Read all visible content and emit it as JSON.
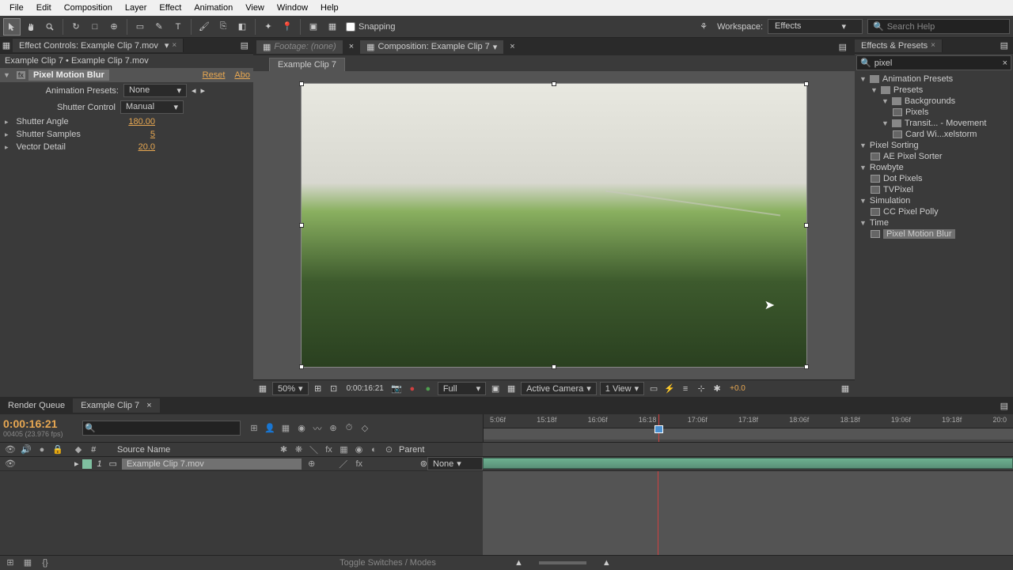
{
  "menubar": [
    "File",
    "Edit",
    "Composition",
    "Layer",
    "Effect",
    "Animation",
    "View",
    "Window",
    "Help"
  ],
  "toolbar": {
    "snapping_label": "Snapping",
    "workspace_label": "Workspace:",
    "workspace_value": "Effects",
    "search_placeholder": "Search Help"
  },
  "effect_controls": {
    "tab_title": "Effect Controls: Example Clip 7.mov",
    "breadcrumb": "Example Clip 7 • Example Clip 7.mov",
    "effect_name": "Pixel Motion Blur",
    "reset_label": "Reset",
    "about_label": "Abo",
    "preset_label": "Animation Presets:",
    "preset_value": "None",
    "props": [
      {
        "label": "Shutter Control",
        "value": "Manual",
        "type": "dropdown"
      },
      {
        "label": "Shutter Angle",
        "value": "180.00",
        "type": "value"
      },
      {
        "label": "Shutter Samples",
        "value": "5",
        "type": "value"
      },
      {
        "label": "Vector Detail",
        "value": "20.0",
        "type": "value"
      }
    ]
  },
  "composition": {
    "footage_tab": "Footage: (none)",
    "comp_tab": "Composition: Example Clip 7",
    "viewer_tab": "Example Clip 7",
    "footer": {
      "zoom": "50%",
      "timecode": "0:00:16:21",
      "resolution": "Full",
      "camera": "Active Camera",
      "view": "1 View",
      "exposure": "+0.0"
    }
  },
  "effects_presets": {
    "title": "Effects & Presets",
    "search_value": "pixel",
    "tree": [
      {
        "label": "Animation Presets",
        "indent": 0,
        "icon": "folder-star",
        "tri": "▼"
      },
      {
        "label": "Presets",
        "indent": 1,
        "icon": "folder",
        "tri": "▼"
      },
      {
        "label": "Backgrounds",
        "indent": 2,
        "icon": "folder",
        "tri": "▼"
      },
      {
        "label": "Pixels",
        "indent": 3,
        "icon": "fx"
      },
      {
        "label": "Transit... - Movement",
        "indent": 2,
        "icon": "folder",
        "tri": "▼"
      },
      {
        "label": "Card Wi...xelstorm",
        "indent": 3,
        "icon": "fx"
      },
      {
        "label": "Pixel Sorting",
        "indent": 0,
        "icon": "",
        "tri": "▼"
      },
      {
        "label": "AE Pixel Sorter",
        "indent": 1,
        "icon": "fx"
      },
      {
        "label": "Rowbyte",
        "indent": 0,
        "icon": "",
        "tri": "▼"
      },
      {
        "label": "Dot Pixels",
        "indent": 1,
        "icon": "fx"
      },
      {
        "label": "TVPixel",
        "indent": 1,
        "icon": "fx"
      },
      {
        "label": "Simulation",
        "indent": 0,
        "icon": "",
        "tri": "▼"
      },
      {
        "label": "CC Pixel Polly",
        "indent": 1,
        "icon": "fx"
      },
      {
        "label": "Time",
        "indent": 0,
        "icon": "",
        "tri": "▼"
      },
      {
        "label": "Pixel Motion Blur",
        "indent": 1,
        "icon": "fx",
        "selected": true
      }
    ]
  },
  "timeline": {
    "tabs": [
      "Render Queue",
      "Example Clip 7"
    ],
    "active_tab": 1,
    "timecode": "0:00:16:21",
    "fps": "00405 (23.976 fps)",
    "col_num": "#",
    "col_source": "Source Name",
    "col_parent": "Parent",
    "ruler": [
      "5:06f",
      "15:18f",
      "16:06f",
      "16:18",
      "17:06f",
      "17:18f",
      "18:06f",
      "18:18f",
      "19:06f",
      "19:18f",
      "20:0"
    ],
    "layers": [
      {
        "num": "1",
        "name": "Example Clip 7.mov",
        "parent": "None"
      }
    ],
    "toggle_label": "Toggle Switches / Modes"
  }
}
